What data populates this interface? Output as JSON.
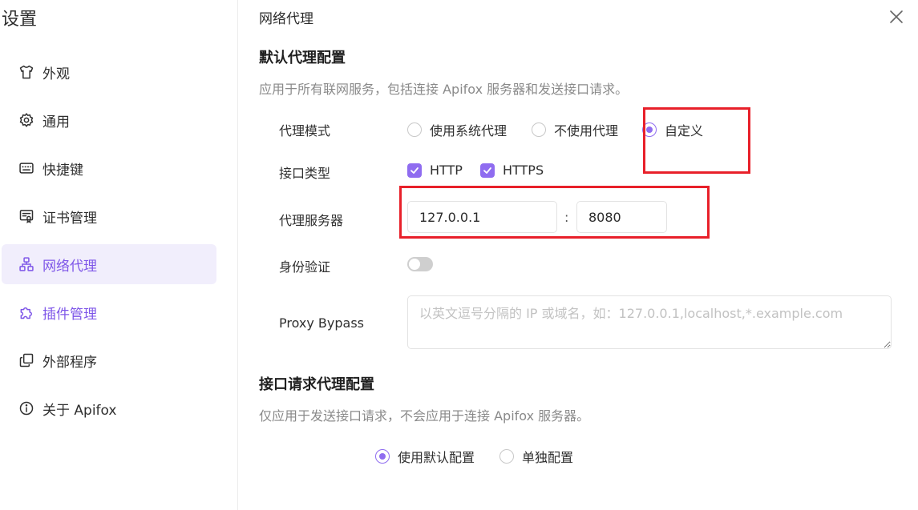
{
  "sidebar": {
    "title": "设置",
    "items": [
      {
        "label": "外观"
      },
      {
        "label": "通用"
      },
      {
        "label": "快捷键"
      },
      {
        "label": "证书管理"
      },
      {
        "label": "网络代理"
      },
      {
        "label": "插件管理"
      },
      {
        "label": "外部程序"
      },
      {
        "label": "关于 Apifox"
      }
    ],
    "active_color": "#7e56e8"
  },
  "main": {
    "title": "网络代理",
    "default_proxy": {
      "title": "默认代理配置",
      "description": "应用于所有联网服务，包括连接 Apifox 服务器和发送接口请求。",
      "mode": {
        "label": "代理模式",
        "options": [
          "使用系统代理",
          "不使用代理",
          "自定义"
        ],
        "selected": "自定义"
      },
      "interface_type": {
        "label": "接口类型",
        "options": [
          "HTTP",
          "HTTPS"
        ]
      },
      "server": {
        "label": "代理服务器",
        "host": "127.0.0.1",
        "colon": ":",
        "port": "8080"
      },
      "auth": {
        "label": "身份验证",
        "enabled": false
      },
      "bypass": {
        "label": "Proxy Bypass",
        "placeholder": "以英文逗号分隔的 IP 或域名，如：127.0.0.1,localhost,*.example.com"
      }
    },
    "request_proxy": {
      "title": "接口请求代理配置",
      "description": "仅应用于发送接口请求，不会应用于连接 Apifox 服务器。",
      "options": [
        "使用默认配置",
        "单独配置"
      ],
      "selected": "使用默认配置"
    }
  },
  "colors": {
    "accent": "#8f6cf0",
    "highlight": "#e8202a"
  }
}
